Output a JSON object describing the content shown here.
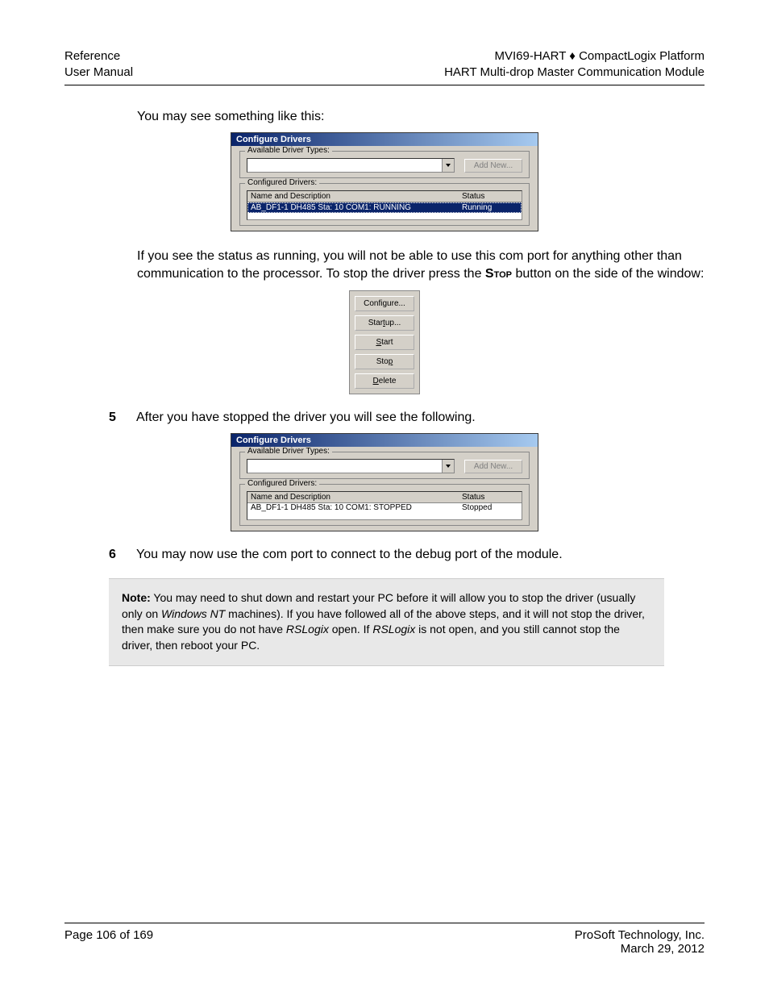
{
  "header": {
    "left_line1": "Reference",
    "left_line2": "User Manual",
    "right_line1": "MVI69-HART ♦ CompactLogix Platform",
    "right_line2": "HART Multi-drop Master Communication Module"
  },
  "intro": "You may see something like this:",
  "dialog1": {
    "title": "Configure Drivers",
    "group_avail": "Available Driver Types:",
    "add_new": "Add New...",
    "group_conf": "Configured Drivers:",
    "col_name": "Name and Description",
    "col_status": "Status",
    "row_name": "AB_DF1-1 DH485 Sta: 10 COM1: RUNNING",
    "row_status": "Running"
  },
  "para1_a": "If you see the status as running, you will not be able to use this com port for anything other than communication to the processor. To stop the driver press the ",
  "para1_b": "Stop",
  "para1_c": " button on the side of the window:",
  "side_buttons": {
    "configure": "Configure...",
    "startup": "Startup...",
    "start": "Start",
    "stop": "Stop",
    "delete": "Delete"
  },
  "step5": {
    "num": "5",
    "text": "After you have stopped the driver you will see the following."
  },
  "dialog2": {
    "title": "Configure Drivers",
    "group_avail": "Available Driver Types:",
    "add_new": "Add New...",
    "group_conf": "Configured Drivers:",
    "col_name": "Name and Description",
    "col_status": "Status",
    "row_name": "AB_DF1-1 DH485 Sta: 10 COM1: STOPPED",
    "row_status": "Stopped"
  },
  "step6": {
    "num": "6",
    "text": "You may now use the com port to connect to the debug port of the module."
  },
  "note": {
    "label": "Note:",
    "part1": " You may need to shut down and restart your PC before it will allow you to stop the driver (usually only on ",
    "em1": "Windows NT",
    "part2": " machines). If you have followed all of the above steps, and it will not stop the driver, then make sure you do not have ",
    "em2": "RSLogix",
    "part3": " open. If ",
    "em3": "RSLogix",
    "part4": " is not open, and you still cannot stop the driver, then reboot your PC."
  },
  "footer": {
    "left": "Page 106 of 169",
    "right_line1": "ProSoft Technology, Inc.",
    "right_line2": "March 29, 2012"
  }
}
